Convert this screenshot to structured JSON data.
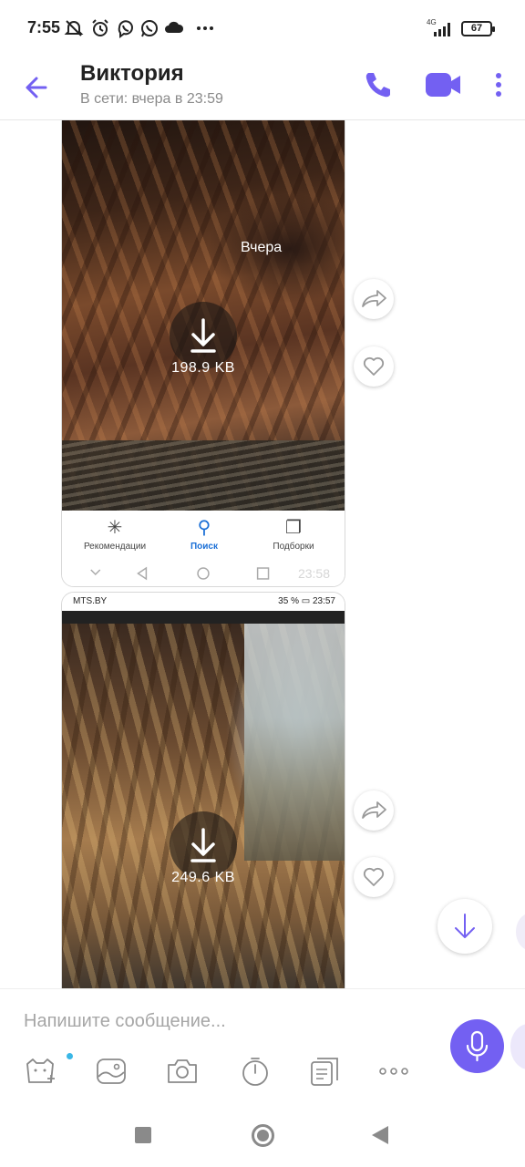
{
  "status_bar": {
    "time": "7:55",
    "network": "4G",
    "battery": "67",
    "icons": [
      "mute-icon",
      "alarm-icon",
      "viber-icon",
      "whatsapp-icon",
      "cloud-icon",
      "more-dots-icon",
      "signal-icon",
      "battery-icon"
    ]
  },
  "header": {
    "contact_name": "Виктория",
    "contact_status": "В сети: вчера в 23:59",
    "accent_color": "#7360f2"
  },
  "messages": [
    {
      "date_label": "Вчера",
      "file_size": "198.9 KB",
      "embedded_nav": {
        "tabs": [
          {
            "label": "Рекомендации",
            "glyph": "✳"
          },
          {
            "label": "Поиск",
            "glyph": "⚲"
          },
          {
            "label": "Подборки",
            "glyph": "❐"
          }
        ],
        "time": "23:58"
      }
    },
    {
      "file_size": "249.6 KB",
      "embedded_status": {
        "carrier": "MTS.BY",
        "right": "35 % ▭ 23:57"
      }
    }
  ],
  "composer": {
    "placeholder": "Напишите сообщение..."
  }
}
